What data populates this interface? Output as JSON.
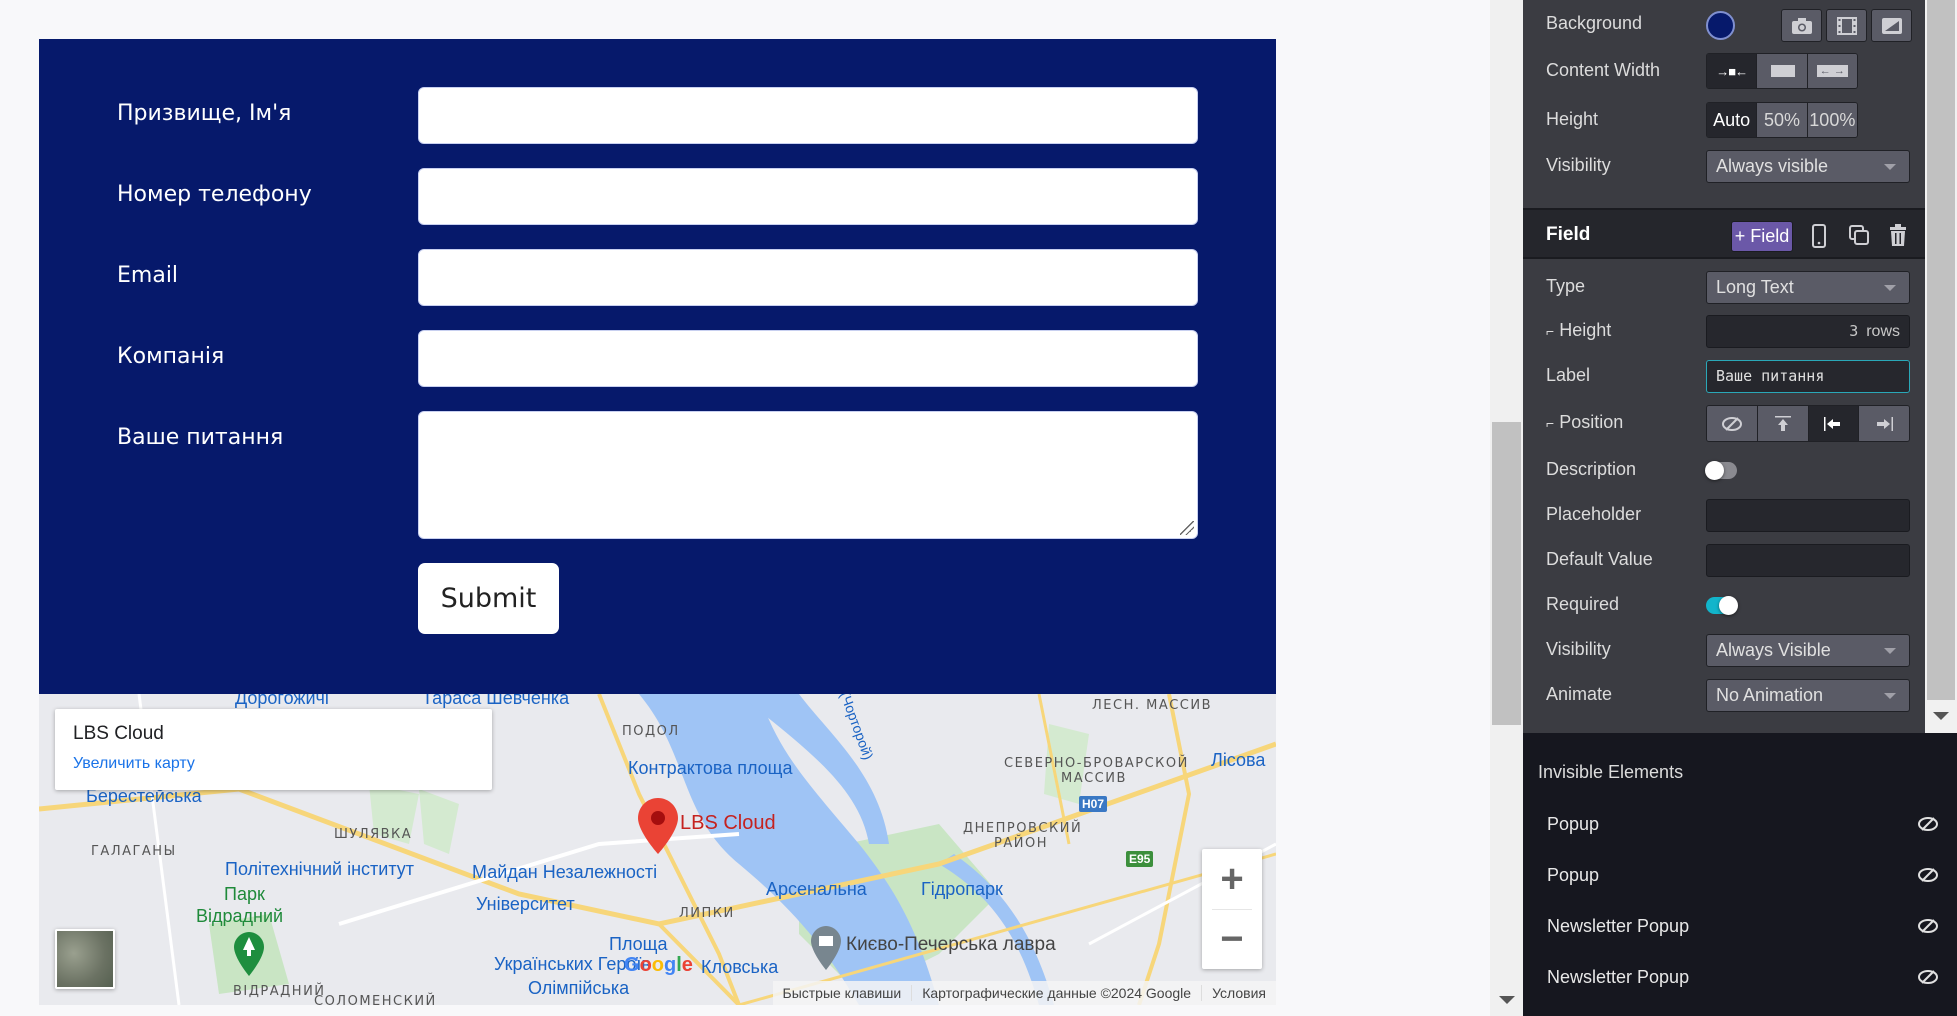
{
  "form": {
    "fields": [
      {
        "label": "Призвище, Ім'я",
        "type": "text",
        "value": ""
      },
      {
        "label": "Номер телефону",
        "type": "text",
        "value": ""
      },
      {
        "label": "Email",
        "type": "text",
        "value": ""
      },
      {
        "label": "Компанія",
        "type": "text",
        "value": ""
      },
      {
        "label": "Ваше питання",
        "type": "textarea",
        "value": ""
      }
    ],
    "submit_label": "Submit",
    "background_color": "#06196b"
  },
  "map": {
    "card_title": "LBS Cloud",
    "card_link": "Увеличить карту",
    "marker_label": "LBS Cloud",
    "zoom_in": "+",
    "zoom_out": "−",
    "logo": "Google",
    "attribution": [
      "Быстрые клавиши",
      "Картографические данные ©2024 Google",
      "Условия"
    ],
    "labels": {
      "dorohozhychi": "Дорогожичі",
      "shevchenka": "Тараса Шевченка",
      "podol": "ПОДОЛ",
      "kontraktova": "Контрактова площа",
      "chortoryi": "ка (Чорторой)",
      "lesn": "ЛЕСН. МАССИВ",
      "sev_brovar_1": "СЕВЕРНО-БРОВАРСКОЙ",
      "sev_brovar_2": "МАССИВ",
      "lisova": "Лісова",
      "berestei": "Берестейська",
      "shuliavka": "ШУЛЯВКА",
      "halahany": "ГАЛАГАНЫ",
      "politech": "Політехнічний інститут",
      "maidan": "Майдан Незалежності",
      "arsenalna": "Арсенальна",
      "hidropark": "Гідропарк",
      "dnipro_1": "ДНЕПРОВСКИЙ",
      "dnipro_2": "РАЙОН",
      "park_1": "Парк",
      "park_2": "Відрадний",
      "universytet": "Університет",
      "lypky": "ЛИПКИ",
      "ploshcha_1": "Площа",
      "ploshcha_2": "Українських Героїв",
      "klovska": "Кловська",
      "lavra": "Києво-Печерська лавра",
      "olimpiiska": "Олімпійська",
      "vidradnyi": "ВІДРАДНИЙ",
      "solomenskyi": "СОЛОМЕНСКИЙ",
      "h07": "H07",
      "e95": "E95"
    }
  },
  "panel": {
    "section": {
      "background_label": "Background",
      "background_color": "#06196b",
      "background_icons": [
        "camera-icon",
        "film-icon",
        "gradient-icon"
      ],
      "content_width_label": "Content Width",
      "content_width_options": [
        "narrow",
        "wide",
        "full"
      ],
      "content_width_selected": "narrow",
      "height_label": "Height",
      "height_options": [
        "Auto",
        "50%",
        "100%"
      ],
      "height_selected": "Auto",
      "visibility_label": "Visibility",
      "visibility_value": "Always visible"
    },
    "field": {
      "title": "Field",
      "add_field_label": "+ Field",
      "type_label": "Type",
      "type_value": "Long Text",
      "height_label": "Height",
      "height_rows": "3",
      "height_unit": "rows",
      "label_label": "Label",
      "label_value": "Ваше питання",
      "position_label": "Position",
      "position_options": [
        "hidden",
        "top",
        "left",
        "right"
      ],
      "position_selected": "left",
      "description_label": "Description",
      "description_enabled": false,
      "placeholder_label": "Placeholder",
      "placeholder_value": "",
      "default_value_label": "Default Value",
      "default_value": "",
      "required_label": "Required",
      "required_enabled": true,
      "visibility_label": "Visibility",
      "visibility_value": "Always Visible",
      "animate_label": "Animate",
      "animate_value": "No Animation",
      "accent_color": "#12b5cb",
      "add_button_color": "#6b58a8"
    },
    "invisible": {
      "title": "Invisible Elements",
      "items": [
        {
          "label": "Popup"
        },
        {
          "label": "Popup"
        },
        {
          "label": "Newsletter Popup"
        },
        {
          "label": "Newsletter Popup"
        }
      ]
    }
  }
}
